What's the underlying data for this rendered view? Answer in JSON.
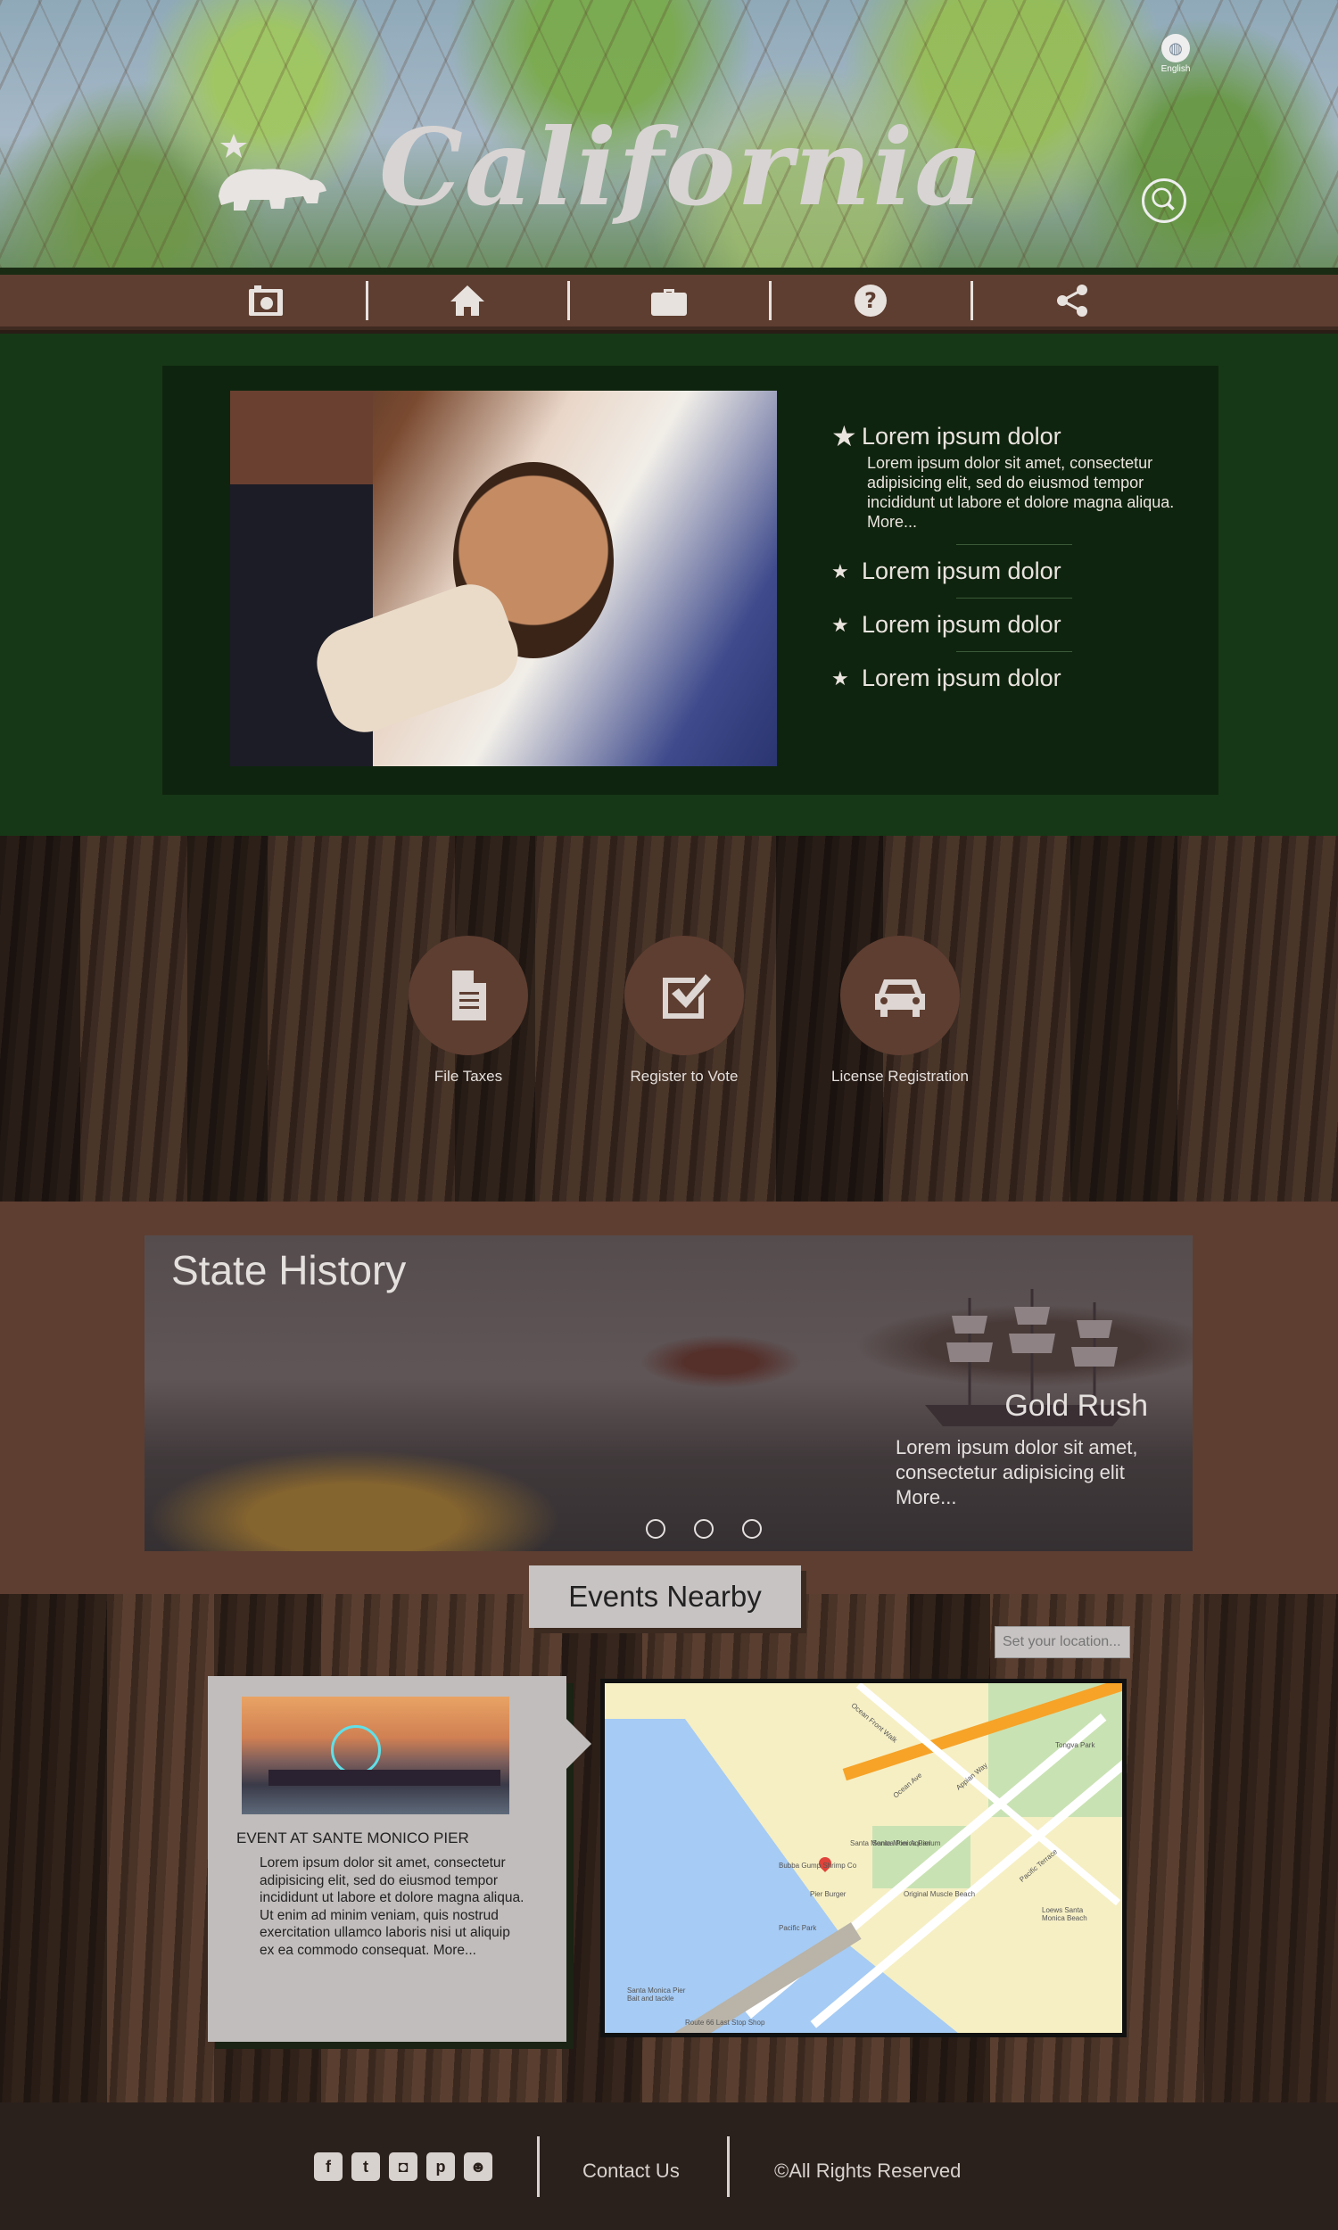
{
  "header": {
    "logo_text": "California",
    "language_label": "English",
    "icons": {
      "language": "globe-icon",
      "search": "search-icon",
      "logo": "bear-star-icon"
    }
  },
  "nav": {
    "items": [
      {
        "icon": "camera-icon"
      },
      {
        "icon": "home-icon"
      },
      {
        "icon": "briefcase-icon"
      },
      {
        "icon": "question-icon"
      },
      {
        "icon": "share-icon"
      }
    ]
  },
  "feature": {
    "items": [
      {
        "title": "Lorem ipsum dolor",
        "desc": "Lorem ipsum dolor sit amet, consectetur adipisicing elit, sed do eiusmod tempor incididunt ut labore et dolore magna aliqua. More..."
      },
      {
        "title": "Lorem ipsum dolor"
      },
      {
        "title": "Lorem ipsum dolor"
      },
      {
        "title": "Lorem ipsum dolor"
      }
    ]
  },
  "services": [
    {
      "label": "File Taxes",
      "icon": "document-icon"
    },
    {
      "label": "Register to Vote",
      "icon": "checkbox-icon"
    },
    {
      "label": "License Registration",
      "icon": "car-icon"
    }
  ],
  "history": {
    "title": "State History",
    "slide_title": "Gold Rush",
    "slide_desc": "Lorem ipsum dolor sit amet, consectetur adipisicing elit More..."
  },
  "events": {
    "tab_label": "Events Nearby",
    "location_placeholder": "Set your location...",
    "card": {
      "title": "EVENT AT SANTE MONICO PIER",
      "desc": "Lorem ipsum dolor sit amet, consectetur adipisicing elit, sed do eiusmod tempor incididunt ut labore et dolore magna aliqua. Ut enim ad minim veniam, quis nostrud exercitation ullamco laboris nisi ut aliquip ex ea commodo consequat. More..."
    },
    "map_labels": [
      "Santa Monica Pier",
      "Pacific Park",
      "Pier Burger",
      "Original Muscle Beach",
      "Santa Monica Pier Aquarium",
      "Tongva Park",
      "Loews Santa Monica Beach",
      "Bubba Gump Shrimp Co",
      "Santa Monica Pier Bait and tackle",
      "Route 66 Last Stop Shop",
      "Ocean Front Walk",
      "Ocean Ave",
      "Appian Way",
      "Pacific Terrace"
    ]
  },
  "footer": {
    "social_icons": [
      "facebook-icon",
      "twitter-icon",
      "instagram-icon",
      "pinterest-icon",
      "reddit-icon"
    ],
    "contact_label": "Contact Us",
    "rights_label": "©All Rights Reserved"
  }
}
